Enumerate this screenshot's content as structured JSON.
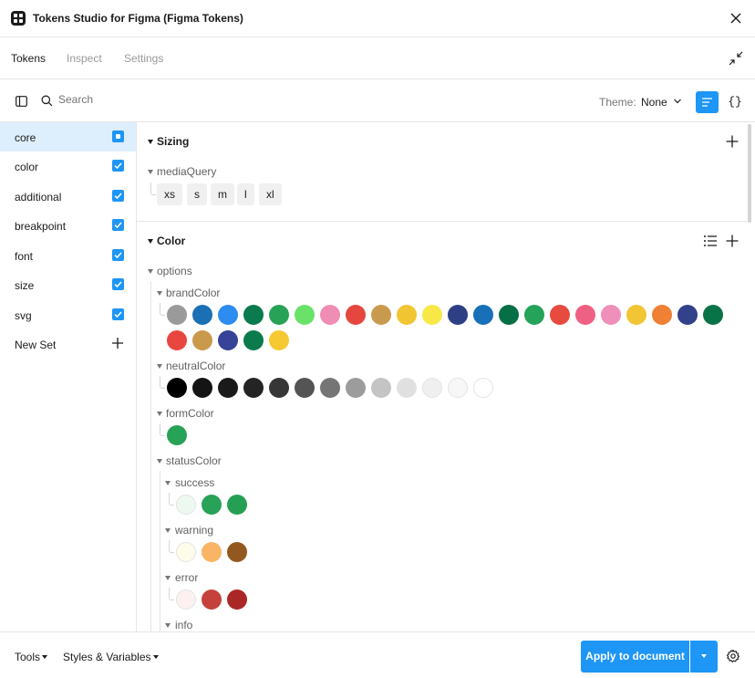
{
  "window": {
    "title": "Tokens Studio for Figma (Figma Tokens)"
  },
  "tabs": [
    {
      "label": "Tokens"
    },
    {
      "label": "Inspect"
    },
    {
      "label": "Settings"
    }
  ],
  "toolbar": {
    "search_placeholder": "Search",
    "theme_label": "Theme:",
    "theme_value": "None",
    "json_view_label": "{}"
  },
  "sidebar": {
    "sets": [
      {
        "label": "core",
        "state": "partial"
      },
      {
        "label": "color",
        "state": "checked"
      },
      {
        "label": "additional",
        "state": "checked"
      },
      {
        "label": "breakpoint",
        "state": "checked"
      },
      {
        "label": "font",
        "state": "checked"
      },
      {
        "label": "size",
        "state": "checked"
      },
      {
        "label": "svg",
        "state": "checked"
      }
    ],
    "new_set_label": "New Set"
  },
  "sizing": {
    "title": "Sizing",
    "group": "mediaQuery",
    "tokens": [
      "xs",
      "s",
      "m",
      "l",
      "xl"
    ]
  },
  "color": {
    "title": "Color",
    "group": "options",
    "brandColor": {
      "label": "brandColor",
      "swatches": [
        "#9a9a9a",
        "#1a6fb5",
        "#2d8cf0",
        "#0a7a4f",
        "#27a257",
        "#6ae26a",
        "#f08db4",
        "#e5473e",
        "#c99a4e",
        "#f0c531",
        "#f7e847",
        "#2e3f84",
        "#1770b8",
        "#076f45",
        "#26a35b",
        "#e84a3f",
        "#ef6184",
        "#f08fb9",
        "#f2c535",
        "#f08033",
        "#324189",
        "#097348",
        "#e8473f",
        "#ca9a4c",
        "#374396",
        "#0b7a4d",
        "#f6c932"
      ]
    },
    "neutralColor": {
      "label": "neutralColor",
      "swatches": [
        "#000000",
        "#141414",
        "#1a1a1a",
        "#242424",
        "#363636",
        "#545454",
        "#757575",
        "#9c9c9c",
        "#c4c4c4",
        "#e0e0e0",
        "#efefef",
        "#f7f7f7",
        "#ffffff"
      ]
    },
    "formColor": {
      "label": "formColor",
      "swatches": [
        "#27a257"
      ]
    },
    "statusColor": {
      "label": "statusColor",
      "success": {
        "label": "success",
        "swatches": [
          "#edf8f1",
          "#27a257",
          "#259f54"
        ]
      },
      "warning": {
        "label": "warning",
        "swatches": [
          "#fdfcea",
          "#f9b465",
          "#935820"
        ]
      },
      "error": {
        "label": "error",
        "swatches": [
          "#fcf0f0",
          "#c5413b",
          "#ab2726"
        ]
      },
      "info": {
        "label": "info"
      }
    }
  },
  "footer": {
    "tools_label": "Tools",
    "styles_label": "Styles & Variables",
    "apply_label": "Apply to document"
  },
  "colors": {
    "accent": "#1e96f5",
    "active_row": "#ddeefd"
  }
}
